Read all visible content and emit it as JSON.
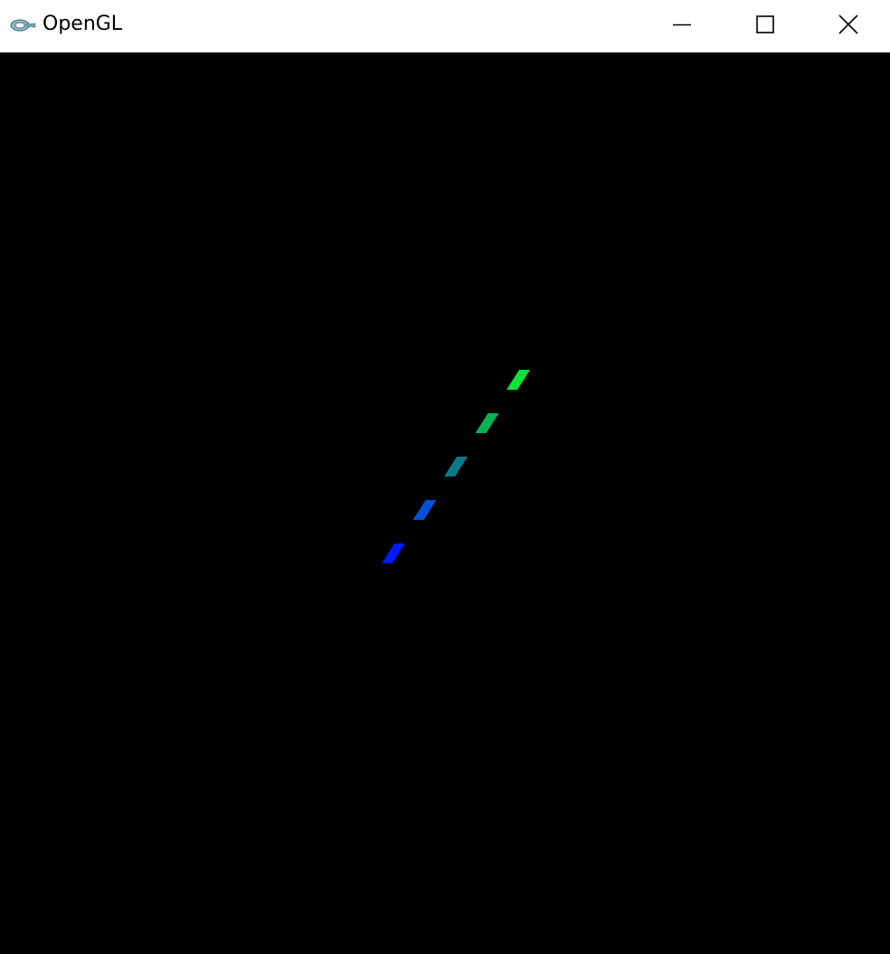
{
  "window": {
    "title": "OpenGL",
    "icon": "opengl-app-icon",
    "controls": [
      {
        "name": "minimize-button",
        "icon": "minimize-icon"
      },
      {
        "name": "maximize-button",
        "icon": "maximize-icon"
      },
      {
        "name": "close-button",
        "icon": "close-icon"
      }
    ]
  },
  "viewport": {
    "background": "#000000",
    "segments": [
      {
        "color": "#0019ff"
      },
      {
        "color": "#0551d2"
      },
      {
        "color": "#0a7a8a"
      },
      {
        "color": "#08b350"
      },
      {
        "color": "#0ce33a"
      }
    ]
  }
}
